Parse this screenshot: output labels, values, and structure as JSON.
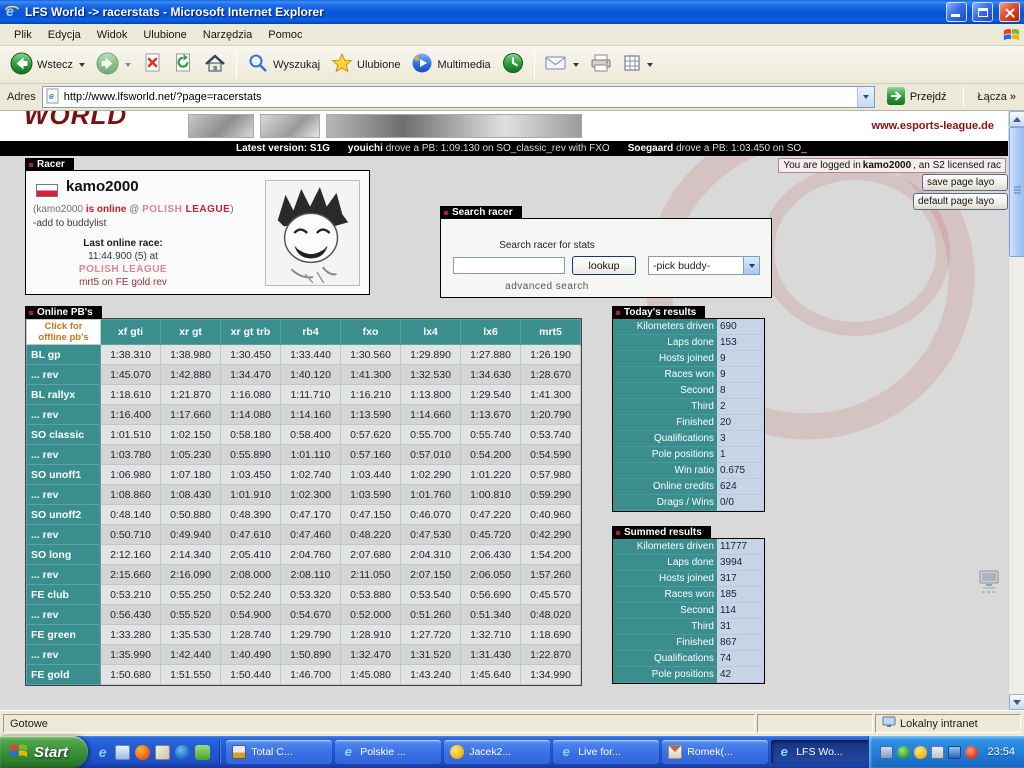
{
  "window": {
    "title": "LFS World -> racerstats - Microsoft Internet Explorer",
    "menus": [
      "Plik",
      "Edycja",
      "Widok",
      "Ulubione",
      "Narzędzia",
      "Pomoc"
    ],
    "toolbar": {
      "back_label": "Wstecz",
      "search_label": "Wyszukaj",
      "favorites_label": "Ulubione",
      "media_label": "Multimedia"
    },
    "address": {
      "label": "Adres",
      "url": "http://www.lfsworld.net/?page=racerstats",
      "go_label": "Przejdź",
      "links_label": "Łącza",
      "links_chevrons": "»"
    },
    "statusbar": {
      "status": "Gotowe",
      "zone": "Lokalny intranet"
    }
  },
  "banner": {
    "logo_text": "WORLD",
    "site_url": "www.esports-league.de"
  },
  "ticker": {
    "latest": "Latest version: S1G",
    "entries": [
      {
        "name": "youichi",
        "text": "drove a PB: 1:09.130 on SO_classic_rev with FXO"
      },
      {
        "name": "Soegaard",
        "text": "drove a PB: 1:03.450 on SO_"
      }
    ]
  },
  "header": {
    "login_pre": "You are logged in",
    "login_user": "kamo2000",
    "login_post": ", an S2 licensed rac",
    "save_layout_label": "save page layo",
    "default_layout_label": "default page layo"
  },
  "racer": {
    "tab": "Racer",
    "name": "kamo2000",
    "status_pre": "(kamo2000 ",
    "status_online": "is online",
    "status_mid": " @ ",
    "status_league1": "POLISH",
    "status_league2": " LEAGUE",
    "status_post": ")",
    "add_buddy": "-add to buddylist",
    "last_race_title": "Last online race:",
    "last_race_time": "11:44.900 (5) at",
    "last_race_league": "POLISH LEAGUE",
    "last_race_combo": "mrt5 on FE gold rev"
  },
  "search": {
    "tab": "Search racer",
    "prompt": "Search racer for stats",
    "input_value": "",
    "lookup_label": "lookup",
    "buddy_value": "-pick buddy-",
    "advanced_label": "advanced search"
  },
  "pbs": {
    "tab": "Online PB's",
    "corner_line1": "Click for",
    "corner_line2": "offline pb's",
    "columns": [
      "xf gti",
      "xr gt",
      "xr gt trb",
      "rb4",
      "fxo",
      "lx4",
      "lx6",
      "mrt5"
    ],
    "rows": [
      {
        "track": "BL gp",
        "times": [
          "1:38.310",
          "1:38.980",
          "1:30.450",
          "1:33.440",
          "1:30.560",
          "1:29.890",
          "1:27.880",
          "1:26.190"
        ]
      },
      {
        "track": "... rev",
        "times": [
          "1:45.070",
          "1:42.880",
          "1:34.470",
          "1:40.120",
          "1:41.300",
          "1:32.530",
          "1:34.630",
          "1:28.670"
        ]
      },
      {
        "track": "BL rallyx",
        "times": [
          "1:18.610",
          "1:21.870",
          "1:16.080",
          "1:11.710",
          "1:16.210",
          "1:13.800",
          "1:29.540",
          "1:41.300"
        ]
      },
      {
        "track": "... rev",
        "times": [
          "1:16.400",
          "1:17.660",
          "1:14.080",
          "1:14.160",
          "1:13.590",
          "1:14.660",
          "1:13.670",
          "1:20.790"
        ]
      },
      {
        "track": "SO classic",
        "times": [
          "1:01.510",
          "1:02.150",
          "0:58.180",
          "0:58.400",
          "0:57.620",
          "0:55.700",
          "0:55.740",
          "0:53.740"
        ]
      },
      {
        "track": "... rev",
        "times": [
          "1:03.780",
          "1:05.230",
          "0:55.890",
          "1:01.110",
          "0:57.160",
          "0:57.010",
          "0:54.200",
          "0:54.590"
        ]
      },
      {
        "track": "SO unoff1",
        "times": [
          "1:06.980",
          "1:07.180",
          "1:03.450",
          "1:02.740",
          "1:03.440",
          "1:02.290",
          "1:01.220",
          "0:57.980"
        ]
      },
      {
        "track": "... rev",
        "times": [
          "1:08.860",
          "1:08.430",
          "1:01.910",
          "1:02.300",
          "1:03.590",
          "1:01.760",
          "1:00.810",
          "0:59.290"
        ]
      },
      {
        "track": "SO unoff2",
        "times": [
          "0:48.140",
          "0:50.880",
          "0:48.390",
          "0:47.170",
          "0:47.150",
          "0:46.070",
          "0:47.220",
          "0:40.960"
        ]
      },
      {
        "track": "... rev",
        "times": [
          "0:50.710",
          "0:49.940",
          "0:47.610",
          "0:47.460",
          "0:48.220",
          "0:47.530",
          "0:45.720",
          "0:42.290"
        ]
      },
      {
        "track": "SO long",
        "times": [
          "2:12.160",
          "2:14.340",
          "2:05.410",
          "2:04.760",
          "2:07.680",
          "2:04.310",
          "2:06.430",
          "1:54.200"
        ]
      },
      {
        "track": "... rev",
        "times": [
          "2:15.660",
          "2:16.090",
          "2:08.000",
          "2:08.110",
          "2:11.050",
          "2:07.150",
          "2:06.050",
          "1:57.260"
        ]
      },
      {
        "track": "FE club",
        "times": [
          "0:53.210",
          "0:55.250",
          "0:52.240",
          "0:53.320",
          "0:53.880",
          "0:53.540",
          "0:56.690",
          "0:45.570"
        ]
      },
      {
        "track": "... rev",
        "times": [
          "0:56.430",
          "0:55.520",
          "0:54.900",
          "0:54.670",
          "0:52.000",
          "0:51.260",
          "0:51.340",
          "0:48.020"
        ]
      },
      {
        "track": "FE green",
        "times": [
          "1:33.280",
          "1:35.530",
          "1:28.740",
          "1:29.790",
          "1:28.910",
          "1:27.720",
          "1:32.710",
          "1:18.690"
        ]
      },
      {
        "track": "... rev",
        "times": [
          "1:35.990",
          "1:42.440",
          "1:40.490",
          "1:50.890",
          "1:32.470",
          "1:31.520",
          "1:31.430",
          "1:22.870"
        ]
      },
      {
        "track": "FE gold",
        "times": [
          "1:50.680",
          "1:51.550",
          "1:50.440",
          "1:46.700",
          "1:45.080",
          "1:43.240",
          "1:45.640",
          "1:34.990"
        ]
      }
    ]
  },
  "today": {
    "tab": "Today's results",
    "rows": [
      {
        "label": "Kilometers driven",
        "value": "690"
      },
      {
        "label": "Laps done",
        "value": "153"
      },
      {
        "label": "Hosts joined",
        "value": "9"
      },
      {
        "label": "Races won",
        "value": "9"
      },
      {
        "label": "Second",
        "value": "8"
      },
      {
        "label": "Third",
        "value": "2"
      },
      {
        "label": "Finished",
        "value": "20"
      },
      {
        "label": "Qualifications",
        "value": "3"
      },
      {
        "label": "Pole positions",
        "value": "1"
      },
      {
        "label": "Win ratio",
        "value": "0.675"
      },
      {
        "label": "Online credits",
        "value": "624"
      },
      {
        "label": "Drags / Wins",
        "value": "0/0"
      }
    ]
  },
  "summed": {
    "tab": "Summed results",
    "rows": [
      {
        "label": "Kilometers driven",
        "value": "11777"
      },
      {
        "label": "Laps done",
        "value": "3994"
      },
      {
        "label": "Hosts joined",
        "value": "317"
      },
      {
        "label": "Races won",
        "value": "185"
      },
      {
        "label": "Second",
        "value": "114"
      },
      {
        "label": "Third",
        "value": "31"
      },
      {
        "label": "Finished",
        "value": "867"
      },
      {
        "label": "Qualifications",
        "value": "74"
      },
      {
        "label": "Pole positions",
        "value": "42"
      }
    ]
  },
  "taskbar": {
    "start_label": "Start",
    "quick_launch": [
      "internet-explorer",
      "outlook-express",
      "firefox",
      "show-desktop",
      "media-player",
      "messenger"
    ],
    "tasks": [
      {
        "label": "Total C...",
        "icon": "total-commander",
        "active": false
      },
      {
        "label": "Polskie ...",
        "icon": "internet-explorer",
        "active": false
      },
      {
        "label": "Jacek2...",
        "icon": "gadu-gadu",
        "active": false
      },
      {
        "label": "Live for...",
        "icon": "internet-explorer",
        "active": false
      },
      {
        "label": "Romek(...",
        "icon": "mail",
        "active": false
      },
      {
        "label": "LFS Wo...",
        "icon": "internet-explorer",
        "active": true
      }
    ],
    "tray_icons": [
      "display",
      "antivirus",
      "messenger-gg",
      "volume",
      "network",
      "updates"
    ],
    "clock": "23:54"
  },
  "colors": {
    "teal": "#3A8E8E",
    "tab_black": "#000000",
    "link_orange": "#C07820",
    "xp_blue": "#2259D3",
    "start_green": "#3D923D"
  }
}
